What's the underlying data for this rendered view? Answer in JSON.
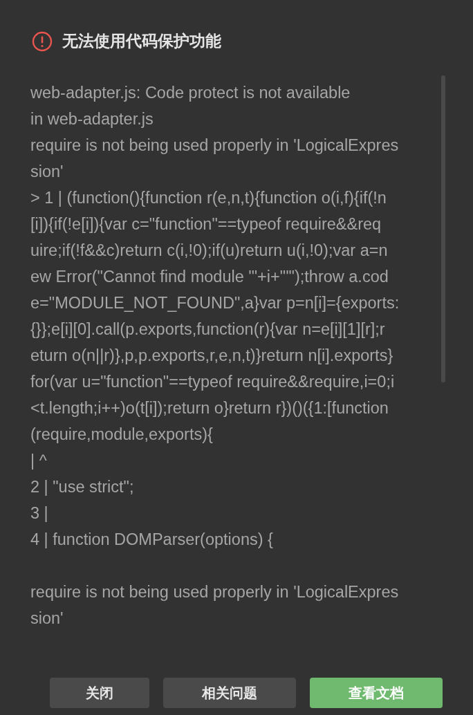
{
  "dialog": {
    "title": "无法使用代码保护功能",
    "error": true
  },
  "message": {
    "paragraphs": [
      [
        "web-adapter.js: Code protect is not available",
        "in web-adapter.js",
        "require is not being used properly in 'LogicalExpres",
        "sion'",
        "> 1 | (function(){function r(e,n,t){function o(i,f){if(!n",
        "[i]){if(!e[i]){var c=\"function\"==typeof require&&req",
        "uire;if(!f&&c)return c(i,!0);if(u)return u(i,!0);var a=n",
        "ew Error(\"Cannot find module '\"+i+\"'\");throw a.cod",
        "e=\"MODULE_NOT_FOUND\",a}var p=n[i]={exports:",
        "{}};e[i][0].call(p.exports,function(r){var n=e[i][1][r];r",
        "eturn o(n||r)},p,p.exports,r,e,n,t)}return n[i].exports}",
        "for(var u=\"function\"==typeof require&&require,i=0;i",
        "<t.length;i++)o(t[i]);return o}return r})()({1:[function",
        "(require,module,exports){",
        "| ^",
        "2 | \"use strict\";",
        "3 |",
        "4 | function DOMParser(options) {"
      ],
      [
        "require is not being used properly in 'LogicalExpres",
        "sion'"
      ]
    ]
  },
  "buttons": [
    {
      "label": "关闭",
      "kind": "secondary"
    },
    {
      "label": "相关问题",
      "kind": "secondary"
    },
    {
      "label": "查看文档",
      "kind": "primary"
    }
  ]
}
